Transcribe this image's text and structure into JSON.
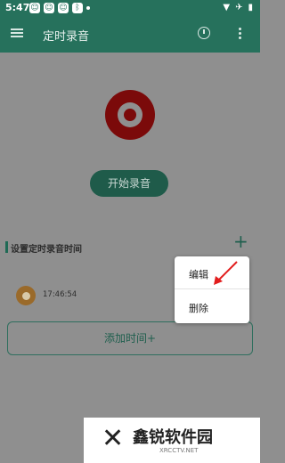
{
  "status_bar": {
    "time": "5:47",
    "notification_icons": [
      "app-icon",
      "app-icon",
      "app-icon",
      "bluetooth-icon"
    ],
    "system_icons": [
      "wifi-icon",
      "airplane-icon",
      "battery-icon"
    ]
  },
  "app_bar": {
    "title": "定时录音",
    "accent_color": "#26715c"
  },
  "main": {
    "start_button_label": "开始录音",
    "section_title": "设置定时录音时间",
    "add_icon": "+",
    "record": {
      "time": "17:46:54",
      "enabled": true
    },
    "add_time_label": "添加时间+"
  },
  "popup_menu": {
    "items": [
      "编辑",
      "删除"
    ]
  },
  "watermark": {
    "brand": "鑫锐软件园",
    "url": "XRCCTV.NET"
  }
}
